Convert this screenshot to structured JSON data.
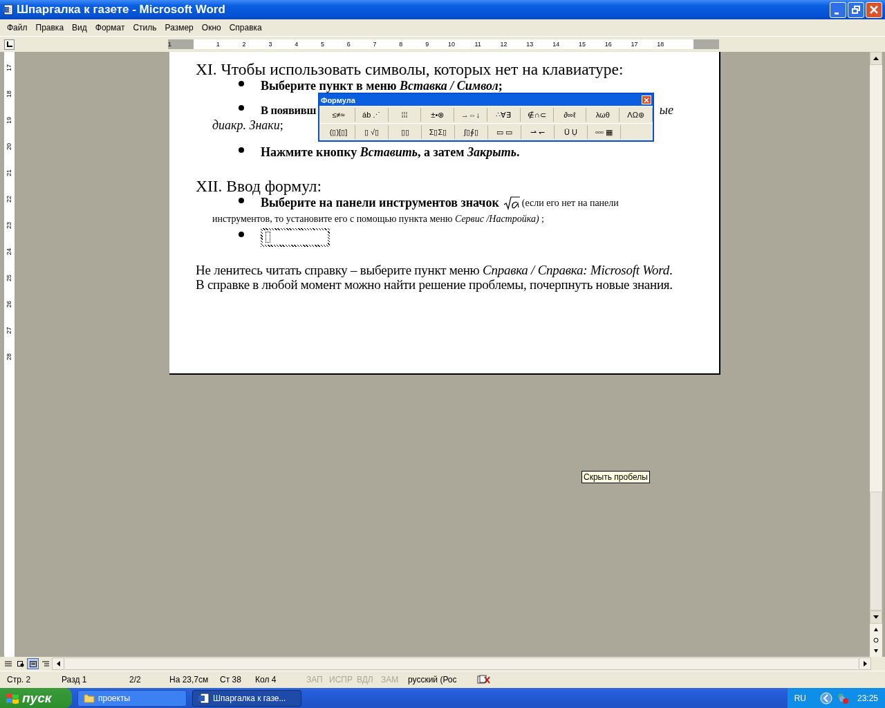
{
  "window": {
    "title": "Шпаргалка к газете - Microsoft Word"
  },
  "menu": [
    "Файл",
    "Правка",
    "Вид",
    "Формат",
    "Стиль",
    "Размер",
    "Окно",
    "Справка"
  ],
  "ruler": {
    "horizontal": [
      "1",
      "1",
      "2",
      "3",
      "4",
      "5",
      "6",
      "7",
      "8",
      "9",
      "10",
      "11",
      "12",
      "13",
      "14",
      "15",
      "16",
      "17",
      "18"
    ],
    "vertical": [
      "17",
      "18",
      "19",
      "20",
      "21",
      "22",
      "23",
      "24",
      "25",
      "26",
      "27",
      "28"
    ]
  },
  "document": [
    {
      "kind": "heading",
      "text": "XI. Чтобы использовать символы, которых нет на клавиатуре:"
    },
    {
      "kind": "bullet",
      "text": "Выберите пункт в меню *Вставка / Символ*;"
    },
    {
      "kind": "split_bullet",
      "left": "В появивш",
      "right": "ые",
      "continuation": "*диакр. Знаки*;"
    },
    {
      "kind": "bullet",
      "text": "Нажмите кнопку *Вставить*, а затем *Закрыть*."
    },
    {
      "kind": "heading",
      "text": "XII. Ввод формул:"
    },
    {
      "kind": "formula_bullet",
      "lead": "Выберите на панели инструментов значок",
      "note": "(если его нет на панели",
      "continuation": "инструментов, то установите его с помощью пункта меню *Сервис /Настройка)* ;"
    },
    {
      "kind": "equation_bullet"
    },
    {
      "kind": "paragraph",
      "text": "Не ленитесь читать справку – выберите пункт меню *Справка / Справка: Microsoft Word*. В справке в любой момент можно найти решение проблемы, почерпнуть новые знания."
    }
  ],
  "formula_toolbar": {
    "title": "Формула",
    "rows": [
      [
        "≤≠≈",
        "ȧb ⋰",
        "⁞⁞⁞",
        "±•⊗",
        "→⇔↓",
        "∴∀∃",
        "∉∩⊂",
        "∂∞ℓ",
        "λωθ",
        "ΛΩ⊛"
      ],
      [
        "(▯)[▯]",
        "▯ √▯",
        "▯▯",
        "Σ▯Σ▯",
        "∫▯∮▯",
        "▭ ▭",
        "⇀ ↽",
        "Ū Ụ",
        "▫▫▫ ▦"
      ]
    ]
  },
  "tooltip": "Скрыть пробелы",
  "status_bar": [
    {
      "text": "Стр. 2",
      "disabled": false
    },
    {
      "text": "Разд 1",
      "disabled": false
    },
    {
      "text": "2/2",
      "disabled": false
    },
    {
      "text": "На 23,7см",
      "disabled": false
    },
    {
      "text": "Ст 38",
      "disabled": false
    },
    {
      "text": "Кол 4",
      "disabled": false
    },
    {
      "text": "ЗАП",
      "disabled": true
    },
    {
      "text": "ИСПР",
      "disabled": true
    },
    {
      "text": "ВДЛ",
      "disabled": true
    },
    {
      "text": "ЗАМ",
      "disabled": true
    },
    {
      "text": "русский (Рос",
      "disabled": false
    }
  ],
  "taskbar": {
    "start": "пуск",
    "tasks": [
      {
        "label": "проекты",
        "selected": false,
        "kind": "folder"
      },
      {
        "label": "Шпаргалка к газе...",
        "selected": true,
        "kind": "word"
      }
    ],
    "language": "RU",
    "clock": "23:25"
  }
}
